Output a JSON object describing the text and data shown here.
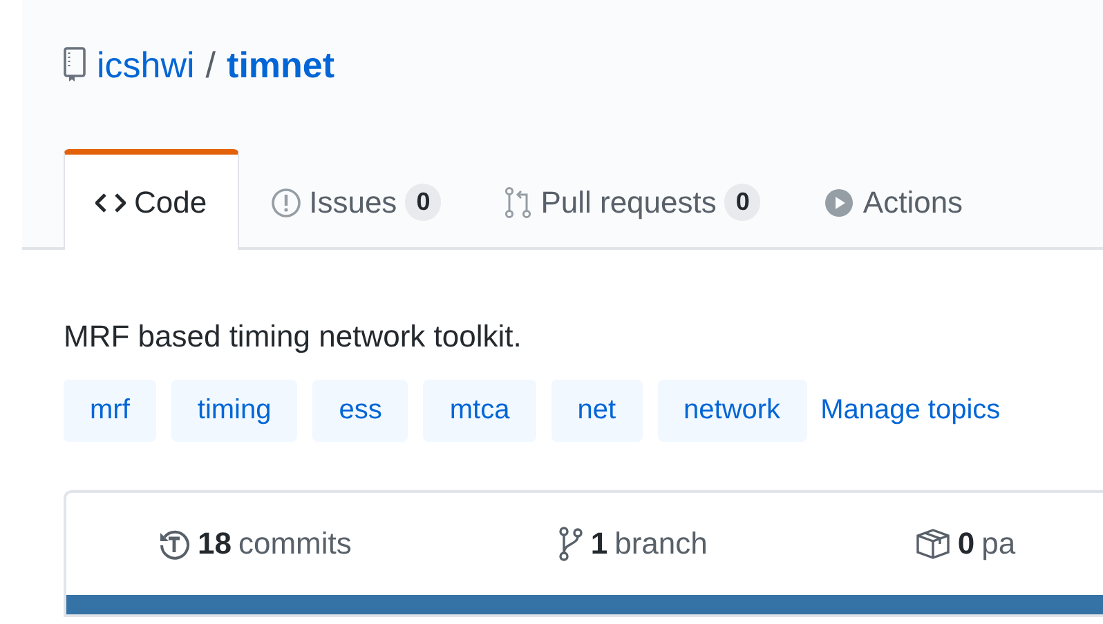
{
  "repo": {
    "owner": "icshwi",
    "separator": "/",
    "name": "timnet"
  },
  "tabs": [
    {
      "label": "Code",
      "selected": true
    },
    {
      "label": "Issues",
      "count": "0",
      "selected": false
    },
    {
      "label": "Pull requests",
      "count": "0",
      "selected": false
    },
    {
      "label": "Actions",
      "selected": false
    }
  ],
  "description": "MRF based timing network toolkit.",
  "topics": [
    "mrf",
    "timing",
    "ess",
    "mtca",
    "net",
    "network"
  ],
  "manage_topics": "Manage topics",
  "stats": [
    {
      "count": "18",
      "label": "commits"
    },
    {
      "count": "1",
      "label": "branch"
    },
    {
      "count": "0",
      "label": "pa"
    }
  ]
}
